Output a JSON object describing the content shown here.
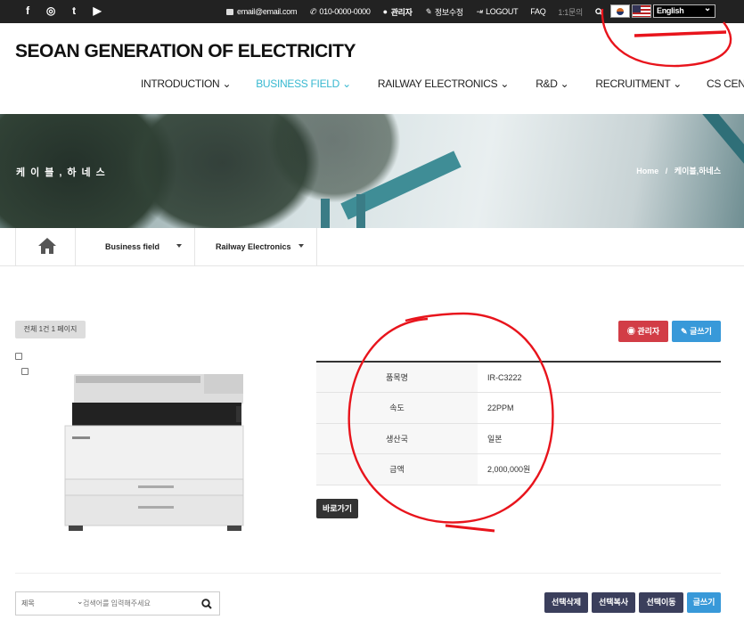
{
  "topbar": {
    "social_icons": [
      "facebook-icon",
      "instagram-icon",
      "twitter-icon",
      "youtube-icon"
    ],
    "social_glyphs": [
      "f",
      "◎",
      "t",
      "▶"
    ],
    "email": "email@email.com",
    "phone": "010-0000-0000",
    "admin": "관리자",
    "edit_info": "정보수정",
    "logout": "LOGOUT",
    "faq": "FAQ",
    "inquiry": "1:1문의",
    "language": "English"
  },
  "header": {
    "logo": "SEOAN GENERATION OF ELECTRICITY",
    "nav": [
      "INTRODUCTION",
      "BUSINESS FIELD",
      "RAILWAY ELECTRONICS",
      "R&D",
      "RECRUITMENT",
      "CS CENTER"
    ],
    "active_nav": "BUSINESS FIELD"
  },
  "hero": {
    "title": "케이블,하네스",
    "breadcrumb_home": "Home",
    "breadcrumb_sep": "/",
    "breadcrumb_current": "케이블,하네스"
  },
  "subnav": {
    "dropdown1": "Business field",
    "dropdown2": "Railway Electronics"
  },
  "board": {
    "total": "전체 1건 1 페이지",
    "admin_button": "관리자",
    "write_button": "글쓰기"
  },
  "product": {
    "rows": [
      {
        "label": "품목명",
        "value": "IR-C3222"
      },
      {
        "label": "속도",
        "value": "22PPM"
      },
      {
        "label": "생산국",
        "value": "일본"
      },
      {
        "label": "금액",
        "value": "2,000,000원"
      }
    ],
    "go_button": "바로가기"
  },
  "bottom": {
    "search_field": "제목",
    "search_placeholder": "검색어를 입력해주세요",
    "delete_button": "선택삭제",
    "copy_button": "선택복사",
    "move_button": "선택이동",
    "write_button": "글쓰기"
  },
  "colors": {
    "accent": "#37b8d0",
    "danger": "#d23d46",
    "primary": "#3899d9",
    "dark_button": "#3b3f5c",
    "annotation": "#e8141c"
  }
}
